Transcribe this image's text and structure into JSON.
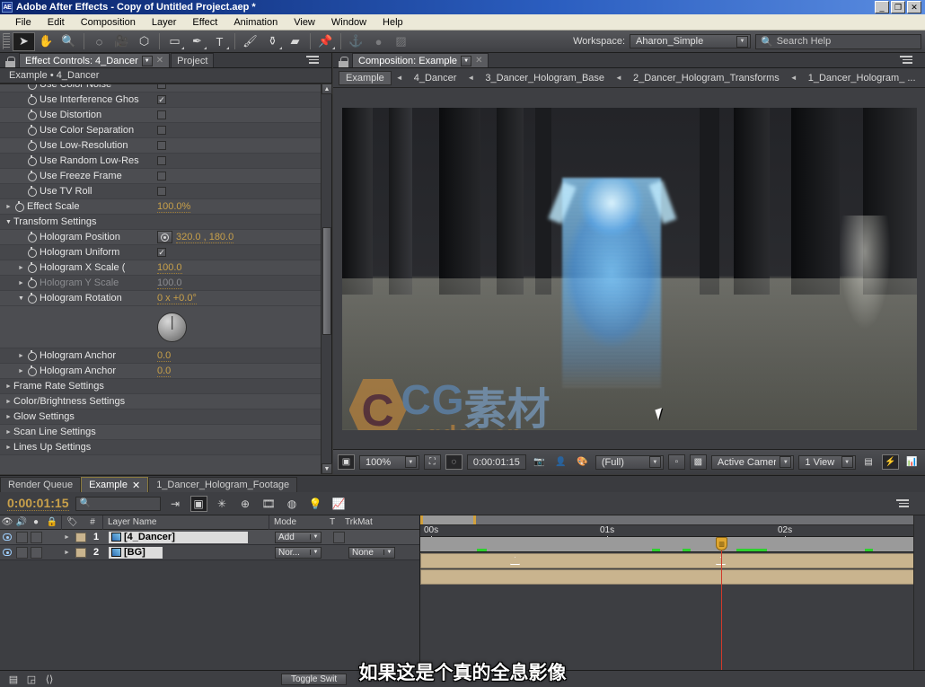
{
  "window": {
    "title": "Adobe After Effects - Copy of Untitled Project.aep *",
    "logo": "AE",
    "minimize": "_",
    "maximize": "❐",
    "close": "✕"
  },
  "menu": {
    "items": [
      "File",
      "Edit",
      "Composition",
      "Layer",
      "Effect",
      "Animation",
      "View",
      "Window",
      "Help"
    ]
  },
  "toolbar": {
    "tools": [
      {
        "name": "selection-tool",
        "glyph": "➤",
        "selected": true
      },
      {
        "name": "hand-tool",
        "glyph": "✋",
        "selected": false
      },
      {
        "name": "zoom-tool",
        "glyph": "🔍",
        "selected": false
      },
      {
        "name": "rotation-tool",
        "glyph": "◌",
        "selected": false
      },
      {
        "name": "camera-tool",
        "glyph": "🎥",
        "selected": false
      },
      {
        "name": "pan-behind-tool",
        "glyph": "⬡",
        "selected": false
      },
      {
        "name": "shape-tool",
        "glyph": "▭",
        "selected": false
      },
      {
        "name": "pen-tool",
        "glyph": "✒",
        "selected": false
      },
      {
        "name": "text-tool",
        "glyph": "T",
        "selected": false
      },
      {
        "name": "brush-tool",
        "glyph": "🖌",
        "selected": false
      },
      {
        "name": "clone-stamp-tool",
        "glyph": "⚱",
        "selected": false
      },
      {
        "name": "eraser-tool",
        "glyph": "▰",
        "selected": false
      },
      {
        "name": "puppet-pin-tool",
        "glyph": "📌",
        "selected": false
      }
    ],
    "workspace_label": "Workspace:",
    "workspace_value": "Aharon_Simple",
    "search_placeholder": "Search Help"
  },
  "effect_controls": {
    "tab_label": "Effect Controls: 4_Dancer",
    "other_tab": "Project",
    "breadcrumb": "Example • 4_Dancer",
    "rows": [
      {
        "name": "Use Color Noise",
        "type": "checkbox",
        "checked": false,
        "indent": 1
      },
      {
        "name": "Use Interference Ghos",
        "type": "checkbox",
        "checked": true,
        "indent": 1
      },
      {
        "name": "Use Distortion",
        "type": "checkbox",
        "checked": false,
        "indent": 1
      },
      {
        "name": "Use Color Separation",
        "type": "checkbox",
        "checked": false,
        "indent": 1
      },
      {
        "name": "Use Low-Resolution",
        "type": "checkbox",
        "checked": false,
        "indent": 1
      },
      {
        "name": "Use Random Low-Res",
        "type": "checkbox",
        "checked": false,
        "indent": 1
      },
      {
        "name": "Use Freeze Frame",
        "type": "checkbox",
        "checked": false,
        "indent": 1
      },
      {
        "name": "Use TV Roll",
        "type": "checkbox",
        "checked": false,
        "indent": 1
      },
      {
        "name": "Effect Scale",
        "type": "value",
        "value": "100.0%",
        "indent": 0,
        "twirl": "closed"
      },
      {
        "name": "Transform Settings",
        "type": "group",
        "indent": 0,
        "twirl": "open"
      },
      {
        "name": "Hologram Position",
        "type": "position",
        "value": "320.0 , 180.0",
        "indent": 1
      },
      {
        "name": "Hologram Uniform",
        "type": "checkbox",
        "checked": true,
        "indent": 1
      },
      {
        "name": "Hologram X Scale (",
        "type": "value",
        "value": "100.0",
        "indent": 1,
        "twirl": "closed"
      },
      {
        "name": "Hologram Y Scale",
        "type": "value",
        "value": "100.0",
        "indent": 1,
        "twirl": "closed",
        "dim": true
      },
      {
        "name": "Hologram Rotation",
        "type": "value",
        "value": "0 x +0.0°",
        "indent": 1,
        "twirl": "open"
      },
      {
        "name": "Hologram Anchor",
        "type": "value",
        "value": "0.0",
        "indent": 1,
        "twirl": "closed"
      },
      {
        "name": "Hologram Anchor",
        "type": "value",
        "value": "0.0",
        "indent": 1,
        "twirl": "closed"
      },
      {
        "name": "Frame Rate Settings",
        "type": "group",
        "indent": 0,
        "twirl": "closed"
      },
      {
        "name": "Color/Brightness Settings",
        "type": "group",
        "indent": 0,
        "twirl": "closed"
      },
      {
        "name": "Glow Settings",
        "type": "group",
        "indent": 0,
        "twirl": "closed"
      },
      {
        "name": "Scan Line Settings",
        "type": "group",
        "indent": 0,
        "twirl": "closed"
      },
      {
        "name": "Lines Up Settings",
        "type": "group",
        "indent": 0,
        "twirl": "closed"
      }
    ]
  },
  "composition": {
    "tab_label": "Composition: Example",
    "breadcrumb": [
      "Example",
      "4_Dancer",
      "3_Dancer_Hologram_Base",
      "2_Dancer_Hologram_Transforms",
      "1_Dancer_Hologram_ ..."
    ],
    "watermark": {
      "cg": "CG",
      "cn": "素材岛",
      "domain": "cgdao.cn"
    },
    "viewer_controls": {
      "zoom": "100%",
      "timecode": "0:00:01:15",
      "resolution": "(Full)",
      "camera": "Active Camera",
      "views": "1 View",
      "region_of_interest_icon": "roi-icon",
      "mask_icon": "mask-icon",
      "snapshot_icon": "snapshot-icon",
      "show_snapshot_icon": "show-snapshot-icon",
      "channel_icon": "channels-icon",
      "transparency_icon": "transparency-grid-icon",
      "guides_icon": "guides-icon",
      "fast_preview_icon": "fast-preview-icon",
      "timeline_icon": "comp-flowchart-icon"
    }
  },
  "timeline": {
    "tabs": [
      {
        "label": "Render Queue",
        "active": false,
        "closable": false
      },
      {
        "label": "Example",
        "active": true,
        "closable": true
      },
      {
        "label": "1_Dancer_Hologram_Footage",
        "active": false,
        "closable": false
      }
    ],
    "current_time": "0:00:01:15",
    "search_placeholder": "",
    "columns": [
      "#",
      "Layer Name",
      "Mode",
      "T",
      "TrkMat"
    ],
    "toggle_switches_button": "Toggle Swit",
    "ruler_ticks": [
      "00s",
      "01s",
      "02s"
    ],
    "layers": [
      {
        "index": "1",
        "name": "[4_Dancer]",
        "mode": "Add",
        "trkmat": "",
        "visible": true
      },
      {
        "index": "2",
        "name": "[BG]",
        "mode": "Nor...",
        "trkmat": "None",
        "visible": true
      }
    ]
  },
  "subtitle": "如果这是个真的全息影像",
  "colors": {
    "accent_orange": "#c8a04a",
    "playhead_red": "#d03a2a",
    "panel_bg": "#3a3b3f",
    "row_bg": "#4c4d51",
    "layer_bar": "#c9b48e",
    "keyframe_green": "#2fd02f",
    "title_blue": "#0a246a"
  }
}
